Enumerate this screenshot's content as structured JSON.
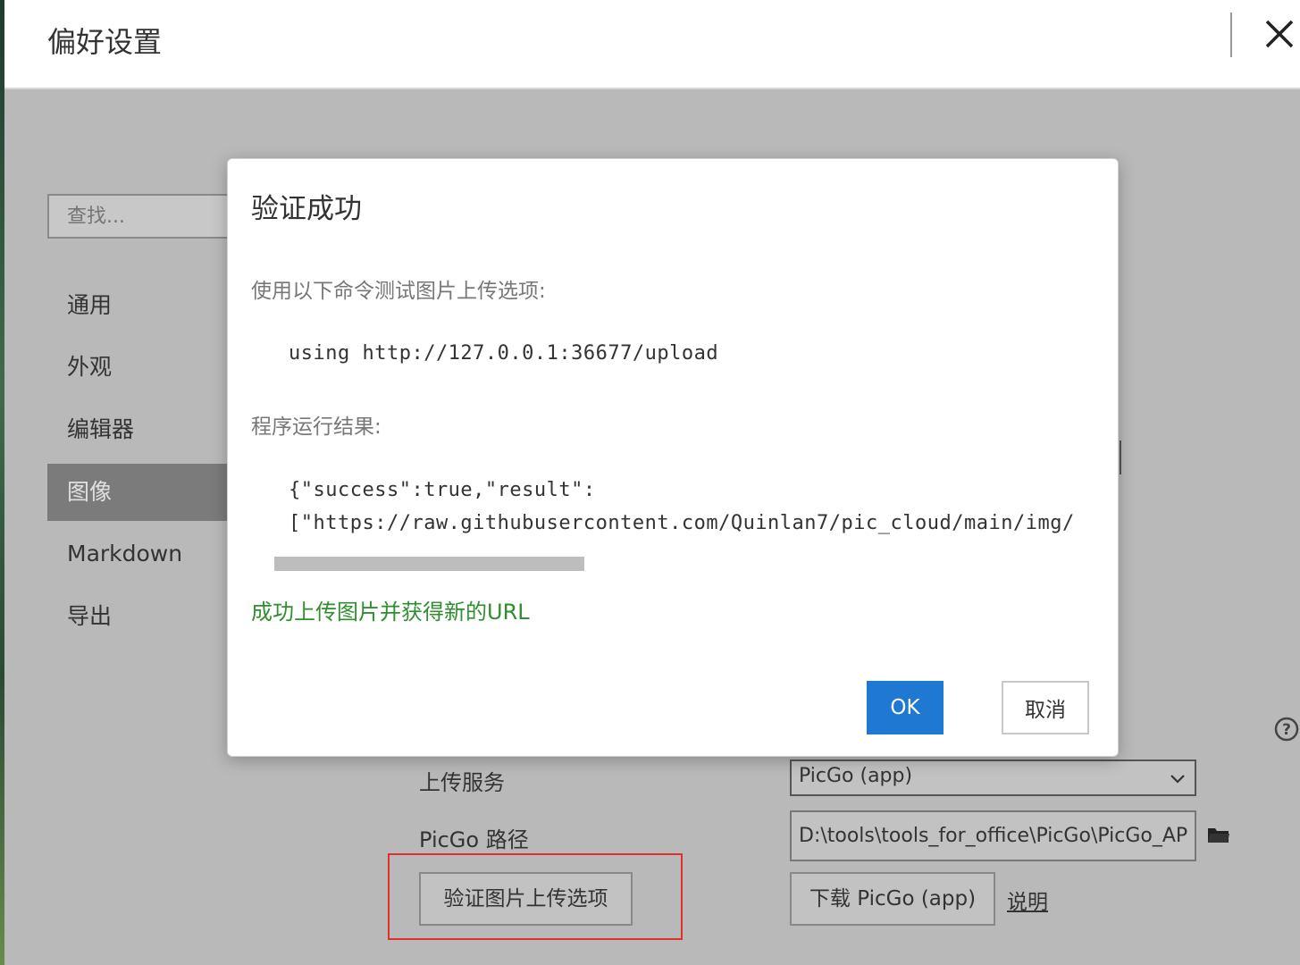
{
  "window": {
    "title": "偏好设置"
  },
  "sidebar": {
    "search_placeholder": "查找...",
    "items": [
      {
        "label": "通用"
      },
      {
        "label": "外观"
      },
      {
        "label": "编辑器"
      },
      {
        "label": "图像",
        "active": true
      },
      {
        "label": "Markdown"
      },
      {
        "label": "导出"
      }
    ]
  },
  "form": {
    "upload_service_label": "上传服务",
    "upload_service_value": "PicGo (app)",
    "picgo_path_label": "PicGo 路径",
    "picgo_path_value": "D:\\tools\\tools_for_office\\PicGo\\PicGo_AP",
    "verify_button": "验证图片上传选项",
    "download_button": "下载 PicGo (app)",
    "help_link": "说明"
  },
  "dialog": {
    "title": "验证成功",
    "test_label": "使用以下命令测试图片上传选项:",
    "command": "using http://127.0.0.1:36677/upload",
    "result_label": "程序运行结果:",
    "result_line1": "{\"success\":true,\"result\":",
    "result_line2": "[\"https://raw.githubusercontent.com/Quinlan7/pic_cloud/main/img/",
    "success_message": "成功上传图片并获得新的URL",
    "ok_button": "OK",
    "cancel_button": "取消"
  },
  "colors": {
    "accent": "#1f79d2",
    "success": "#2f8f2f",
    "highlight": "#e0302b",
    "overlay": "#b9b9b9"
  },
  "icons": [
    "close-icon",
    "chevron-down-icon",
    "folder-icon",
    "help-icon"
  ]
}
